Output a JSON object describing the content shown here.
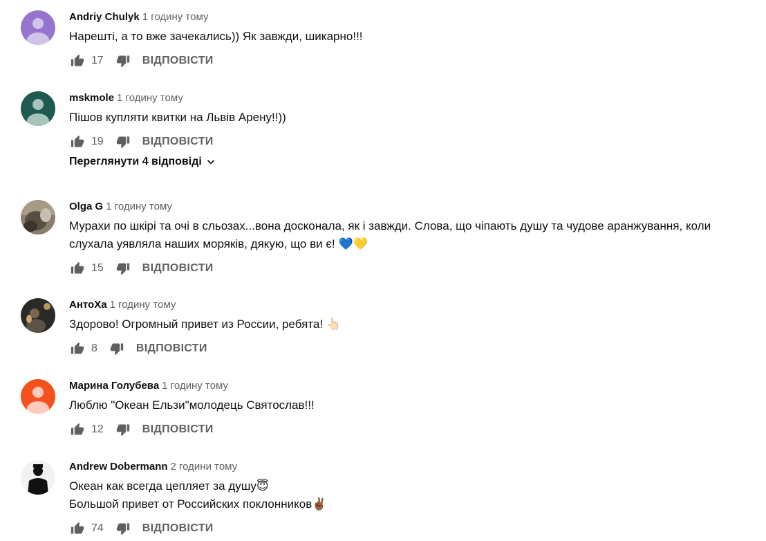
{
  "labels": {
    "reply": "ВІДПОВІСТИ",
    "view_replies": "Переглянути 4 відповіді"
  },
  "colors": {
    "avatar_purple": "#9575cd",
    "avatar_green": "#1e5a4f",
    "avatar_orange": "#f4511e",
    "secondary_text": "#606060"
  },
  "comments": [
    {
      "author": "Andriy Chulyk",
      "time": "1 годину тому",
      "lines": [
        "Нарешті, а то вже зачекались)) Як завжди, шикарно!!!"
      ],
      "likes": "17",
      "avatar": "default-avatar-purple"
    },
    {
      "author": "mskmole",
      "time": "1 годину тому",
      "lines": [
        "Пішов купляти квитки на Львів Арену!!))"
      ],
      "likes": "19",
      "avatar": "default-avatar-green"
    },
    {
      "author": "Olga G",
      "time": "1 годину тому",
      "lines": [
        "Мурахи по шкірі та очі в сльозах...вона досконала, як і завжди. Слова, що чіпають душу та чудове аранжування, коли",
        "слухала уявляла наших моряків, дякую, що ви є! 💙💛"
      ],
      "likes": "15",
      "avatar": "photo-avatar"
    },
    {
      "author": "АнтоХа",
      "time": "1 годину тому",
      "lines": [
        "Здорово! Огромный привет из России, ребята! 👆🏻"
      ],
      "likes": "8",
      "avatar": "photo-avatar"
    },
    {
      "author": "Марина Голубева",
      "time": "1 годину тому",
      "lines": [
        "Люблю \"Океан Ельзи\"молодець Святослав!!!"
      ],
      "likes": "12",
      "avatar": "default-avatar-orange"
    },
    {
      "author": "Andrew Dobermann",
      "time": "2 години тому",
      "lines": [
        "Океан как всегда цепляет за душу😇",
        "Большой привет от Российских поклонников✌🏾"
      ],
      "likes": "74",
      "avatar": "silhouette-avatar"
    }
  ]
}
